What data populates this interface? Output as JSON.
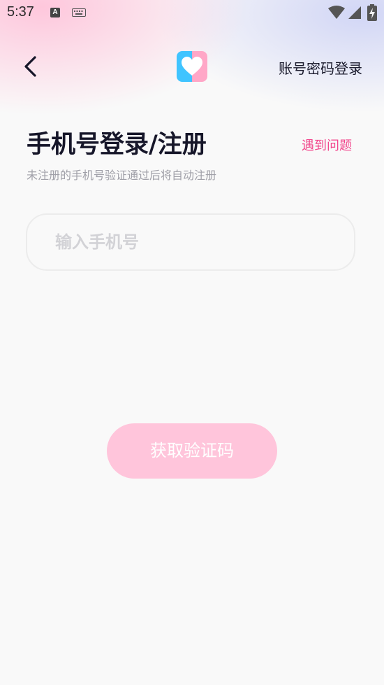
{
  "status_bar": {
    "time": "5:37",
    "a_icon_label": "A"
  },
  "header": {
    "password_login_label": "账号密码登录"
  },
  "main": {
    "title": "手机号登录/注册",
    "help_label": "遇到问题",
    "subtitle": "未注册的手机号验证通过后将自动注册",
    "phone_placeholder": "输入手机号",
    "phone_value": ""
  },
  "actions": {
    "get_code_label": "获取验证码"
  },
  "colors": {
    "accent": "#f2468c",
    "button_bg": "#ffc5db",
    "logo_left": "#40c4ff",
    "logo_right": "#ffa7c7"
  },
  "icons": {
    "back": "chevron-left-icon",
    "logo": "heart-icon"
  }
}
